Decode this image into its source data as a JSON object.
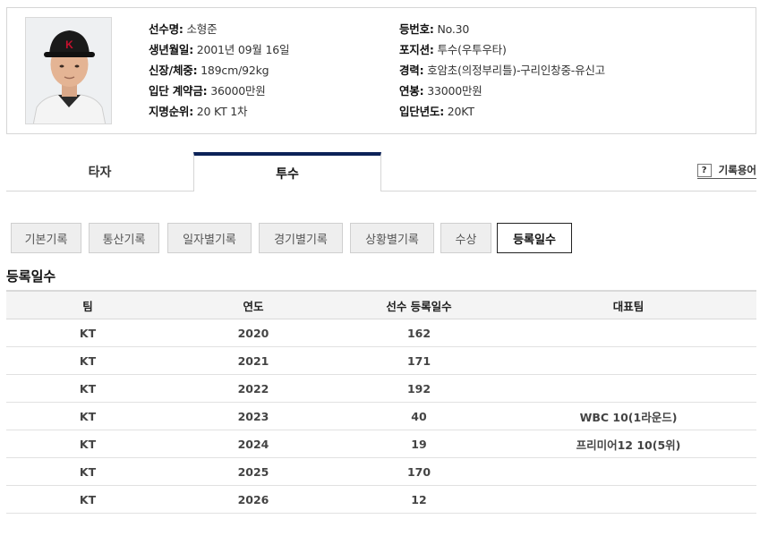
{
  "profile": {
    "rows": [
      {
        "label": "선수명:",
        "value": "소형준"
      },
      {
        "label": "생년월일:",
        "value": "2001년 09월 16일"
      },
      {
        "label": "신장/체중:",
        "value": "189cm/92kg"
      },
      {
        "label": "입단 계약금:",
        "value": "36000만원"
      },
      {
        "label": "지명순위:",
        "value": "20 KT 1차"
      },
      {
        "label": "등번호:",
        "value": "No.30"
      },
      {
        "label": "포지션:",
        "value": "투수(우투우타)"
      },
      {
        "label": "경력:",
        "value": "호암초(의정부리틀)-구리인창중-유신고"
      },
      {
        "label": "연봉:",
        "value": "33000만원"
      },
      {
        "label": "입단년도:",
        "value": "20KT"
      }
    ]
  },
  "tabs": {
    "hitter": "타자",
    "pitcher": "투수",
    "glossary_icon": "?",
    "glossary": "기록용어"
  },
  "subtabs": [
    "기본기록",
    "통산기록",
    "일자별기록",
    "경기별기록",
    "상황별기록",
    "수상",
    "등록일수"
  ],
  "section_title": "등록일수",
  "table": {
    "headers": [
      "팀",
      "연도",
      "선수 등록일수",
      "대표팀"
    ],
    "rows": [
      [
        "KT",
        "2020",
        "162",
        ""
      ],
      [
        "KT",
        "2021",
        "171",
        ""
      ],
      [
        "KT",
        "2022",
        "192",
        ""
      ],
      [
        "KT",
        "2023",
        "40",
        "WBC 10(1라운드)"
      ],
      [
        "KT",
        "2024",
        "19",
        "프리미어12 10(5위)"
      ],
      [
        "KT",
        "2025",
        "170",
        ""
      ],
      [
        "KT",
        "2026",
        "12",
        ""
      ]
    ]
  },
  "colors": {
    "active_tab_accent": "#0c2258",
    "cap": "#1a1a1a",
    "cap_logo": "#c8102e"
  }
}
